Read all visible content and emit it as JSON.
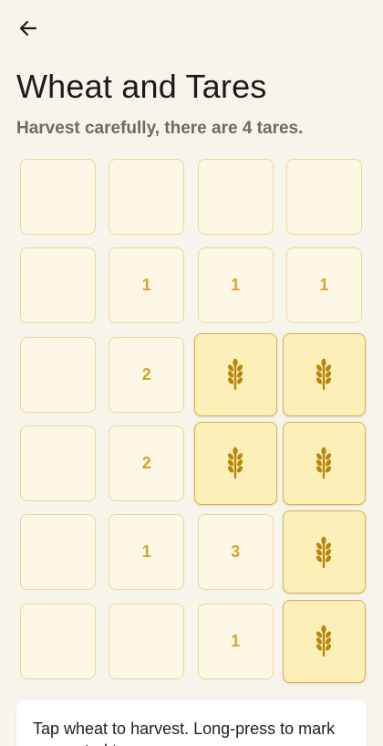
{
  "header": {
    "back_icon": "arrow-left-icon",
    "title": "Wheat and Tares",
    "subtitle": "Harvest carefully, there are 4 tares."
  },
  "board": {
    "rows": 6,
    "cols": 4,
    "wheat_icon": "wheat-icon",
    "colors": {
      "revealed_bg": "#fdf8e5",
      "wheat_bg": "#fdefb8",
      "number": "#d4a52a",
      "wheat_icon": "#b8860b"
    },
    "cells": [
      [
        "",
        "",
        "",
        ""
      ],
      [
        "",
        "1",
        "1",
        "1"
      ],
      [
        "",
        "2",
        "wheat",
        "wheat"
      ],
      [
        "",
        "2",
        "wheat",
        "wheat"
      ],
      [
        "",
        "1",
        "3",
        "wheat"
      ],
      [
        "",
        "",
        "1",
        "wheat"
      ]
    ]
  },
  "hint": {
    "text": "Tap wheat to harvest. Long-press to mark suspected tares."
  }
}
